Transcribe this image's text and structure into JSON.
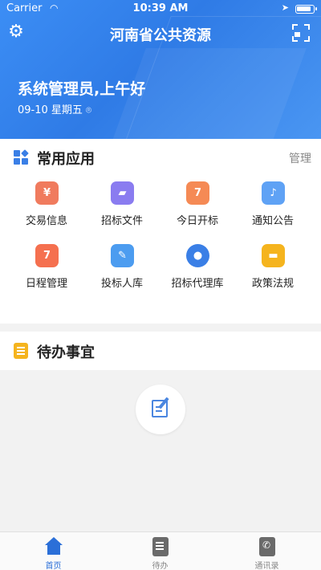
{
  "status_bar": {
    "carrier": "Carrier",
    "time": "10:39 AM"
  },
  "header": {
    "title": "河南省公共资源",
    "greeting": "系统管理员,上午好",
    "date": "09-10 星期五"
  },
  "apps_section": {
    "title": "常用应用",
    "manage_label": "管理",
    "items": [
      {
        "label": "交易信息",
        "icon": "yen-coin-icon",
        "color": "#f07b5e",
        "glyph": "¥"
      },
      {
        "label": "招标文件",
        "icon": "folder-icon",
        "color": "#8a7cf0",
        "glyph": "▰"
      },
      {
        "label": "今日开标",
        "icon": "calendar-icon",
        "color": "#f58a55",
        "glyph": "7"
      },
      {
        "label": "通知公告",
        "icon": "bell-icon",
        "color": "#5fa2f5",
        "glyph": "♪"
      },
      {
        "label": "日程管理",
        "icon": "calendar-icon",
        "color": "#f5704f",
        "glyph": "7"
      },
      {
        "label": "投标人库",
        "icon": "bidder-icon",
        "color": "#4c9cf0",
        "glyph": "✎"
      },
      {
        "label": "招标代理库",
        "icon": "person-icon",
        "color": "#3a7fe6",
        "glyph": "●"
      },
      {
        "label": "政策法规",
        "icon": "folder-icon",
        "color": "#f5b41e",
        "glyph": "▬"
      }
    ]
  },
  "todo_section": {
    "title": "待办事宜"
  },
  "tabbar": {
    "tabs": [
      {
        "label": "首页",
        "icon": "home-icon",
        "active": true
      },
      {
        "label": "待办",
        "icon": "todo-doc-icon",
        "active": false
      },
      {
        "label": "通讯录",
        "icon": "contacts-icon",
        "active": false
      }
    ],
    "accent": "#2b6fd8"
  }
}
